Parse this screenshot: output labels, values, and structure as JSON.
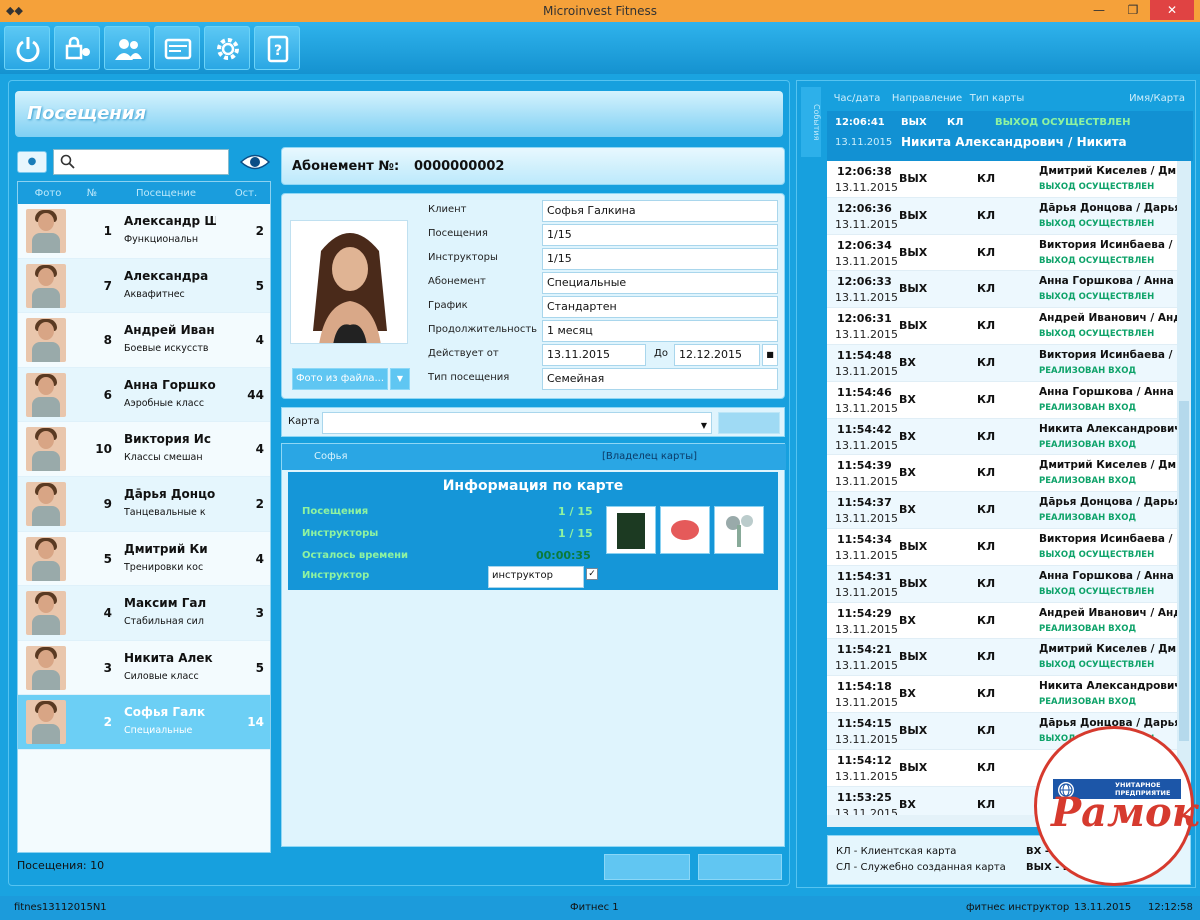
{
  "window": {
    "title": "Microinvest Fitness"
  },
  "page": {
    "title": "Посещения"
  },
  "client_table": {
    "headers": [
      "Фото",
      "№",
      "Посещение",
      "Ост."
    ],
    "rows": [
      {
        "num": "1",
        "name": "Александр Ш",
        "sub": "Функциональн",
        "rem": "2"
      },
      {
        "num": "7",
        "name": "Александра",
        "sub": "Аквафитнес",
        "rem": "5"
      },
      {
        "num": "8",
        "name": "Андрей Иван",
        "sub": "Боевые искусств",
        "rem": "4"
      },
      {
        "num": "6",
        "name": "Анна Горшко",
        "sub": "Аэробные класс",
        "rem": "44"
      },
      {
        "num": "10",
        "name": "Виктория Ис",
        "sub": "Классы смешан",
        "rem": "4"
      },
      {
        "num": "9",
        "name": "Дāрья Донцо",
        "sub": "Танцевальные к",
        "rem": "2"
      },
      {
        "num": "5",
        "name": "Дмитрий Ки",
        "sub": "Тренировки кос",
        "rem": "4"
      },
      {
        "num": "4",
        "name": "Максим Гал",
        "sub": "Стабильная сил",
        "rem": "3"
      },
      {
        "num": "3",
        "name": "Никита Алек",
        "sub": "Силовые класс",
        "rem": "5"
      },
      {
        "num": "2",
        "name": "Софья Галк",
        "sub": "Специальные",
        "rem": "14"
      }
    ],
    "selected_index": 9
  },
  "visits_count": "Посещения: 10",
  "subscription": {
    "label": "Абонемент №:",
    "number": "0000000002",
    "fields": [
      {
        "label": "Клиент",
        "value": "Софья Галкина"
      },
      {
        "label": "Посещения",
        "value": "1/15"
      },
      {
        "label": "Инструкторы",
        "value": "1/15"
      },
      {
        "label": "Абонемент",
        "value": "Специальные"
      },
      {
        "label": "График",
        "value": "Стандартен"
      },
      {
        "label": "Продолжительность",
        "value": "1 месяц"
      }
    ],
    "valid_from_label": "Действует от",
    "valid_from": "13.11.2015",
    "to_label": "До",
    "valid_to": "12.12.2015",
    "visit_type_label": "Тип посещения",
    "visit_type": "Семейная",
    "photo_button": "Фото из файла..."
  },
  "card": {
    "label": "Карта",
    "tab_owner": "Софья",
    "tab_role": "[Владелец карты]",
    "info_title": "Информация по карте",
    "rows": [
      {
        "label": "Посещения",
        "value": "1 / 15"
      },
      {
        "label": "Инструкторы",
        "value": "1 / 15"
      },
      {
        "label": "Осталось времени",
        "value": "00:00:35"
      },
      {
        "label": "Инструктор",
        "value": "инструктор"
      }
    ]
  },
  "events": {
    "side_tab": "События",
    "headers": [
      "Час/дата",
      "Направление",
      "Тип карты",
      "Имя/Карта"
    ],
    "latest": {
      "time": "12:06:41",
      "date": "13.11.2015",
      "dir": "ВЫХ",
      "type": "КЛ",
      "status": "ВЫХОД ОСУЩЕСТВЛЕН",
      "name": "Никита Александрович / Никита"
    },
    "rows": [
      {
        "time": "12:06:38",
        "date": "13.11.2015",
        "dir": "ВЫХ",
        "type": "КЛ",
        "name": "Дмитрий Киселев / Дми",
        "status": "ВЫХОД ОСУЩЕСТВЛЕН"
      },
      {
        "time": "12:06:36",
        "date": "13.11.2015",
        "dir": "ВЫХ",
        "type": "КЛ",
        "name": "Дāрья Донцова / Дарья",
        "status": "ВЫХОД ОСУЩЕСТВЛЕН"
      },
      {
        "time": "12:06:34",
        "date": "13.11.2015",
        "dir": "ВЫХ",
        "type": "КЛ",
        "name": "Виктория Исинбаева / В",
        "status": "ВЫХОД ОСУЩЕСТВЛЕН"
      },
      {
        "time": "12:06:33",
        "date": "13.11.2015",
        "dir": "ВЫХ",
        "type": "КЛ",
        "name": "Анна Горшкова / Анна",
        "status": "ВЫХОД ОСУЩЕСТВЛЕН"
      },
      {
        "time": "12:06:31",
        "date": "13.11.2015",
        "dir": "ВЫХ",
        "type": "КЛ",
        "name": "Андрей Иванович / Анд",
        "status": "ВЫХОД ОСУЩЕСТВЛЕН"
      },
      {
        "time": "11:54:48",
        "date": "13.11.2015",
        "dir": "ВХ",
        "type": "КЛ",
        "name": "Виктория Исинбаева / В",
        "status": "РЕАЛИЗОВАН ВХОД"
      },
      {
        "time": "11:54:46",
        "date": "13.11.2015",
        "dir": "ВХ",
        "type": "КЛ",
        "name": "Анна Горшкова / Анна",
        "status": "РЕАЛИЗОВАН ВХОД"
      },
      {
        "time": "11:54:42",
        "date": "13.11.2015",
        "dir": "ВХ",
        "type": "КЛ",
        "name": "Никита Александрович /",
        "status": "РЕАЛИЗОВАН ВХОД"
      },
      {
        "time": "11:54:39",
        "date": "13.11.2015",
        "dir": "ВХ",
        "type": "КЛ",
        "name": "Дмитрий Киселев / Дми",
        "status": "РЕАЛИЗОВАН ВХОД"
      },
      {
        "time": "11:54:37",
        "date": "13.11.2015",
        "dir": "ВХ",
        "type": "КЛ",
        "name": "Дāрья Донцова / Дарья",
        "status": "РЕАЛИЗОВАН ВХОД"
      },
      {
        "time": "11:54:34",
        "date": "13.11.2015",
        "dir": "ВЫХ",
        "type": "КЛ",
        "name": "Виктория Исинбаева / В",
        "status": "ВЫХОД ОСУЩЕСТВЛЕН"
      },
      {
        "time": "11:54:31",
        "date": "13.11.2015",
        "dir": "ВЫХ",
        "type": "КЛ",
        "name": "Анна Горшкова / Анна",
        "status": "ВЫХОД ОСУЩЕСТВЛЕН"
      },
      {
        "time": "11:54:29",
        "date": "13.11.2015",
        "dir": "ВХ",
        "type": "КЛ",
        "name": "Андрей Иванович / Анд",
        "status": "РЕАЛИЗОВАН ВХОД"
      },
      {
        "time": "11:54:21",
        "date": "13.11.2015",
        "dir": "ВЫХ",
        "type": "КЛ",
        "name": "Дмитрий Киселев / Дми",
        "status": "ВЫХОД ОСУЩЕСТВЛЕН"
      },
      {
        "time": "11:54:18",
        "date": "13.11.2015",
        "dir": "ВХ",
        "type": "КЛ",
        "name": "Никита Александрович /",
        "status": "РЕАЛИЗОВАН ВХОД"
      },
      {
        "time": "11:54:15",
        "date": "13.11.2015",
        "dir": "ВЫХ",
        "type": "КЛ",
        "name": "Дāрья Донцова / Дарья",
        "status": "ВЫХОД ОСУЩЕСТВЛЕН"
      },
      {
        "time": "11:54:12",
        "date": "13.11.2015",
        "dir": "ВЫХ",
        "type": "КЛ",
        "name": "",
        "status": ""
      },
      {
        "time": "11:53:25",
        "date": "13.11.2015",
        "dir": "ВХ",
        "type": "КЛ",
        "name": "",
        "status": ""
      }
    ],
    "legend": {
      "kl": "КЛ - Клиентская карта",
      "sl": "СЛ - Служебно созданная карта",
      "vx": "ВХ - Вход",
      "vyx": "ВЫХ - Выход"
    }
  },
  "status_bar": {
    "left": "fitnes13112015N1",
    "center": "Фитнес 1",
    "user": "фитнес инструктор",
    "date": "13.11.2015",
    "time": "12:12:58"
  },
  "watermark": {
    "small": "УНИТАРНОЕ ПРЕДПРИЯТИЕ",
    "big": "Рамок"
  },
  "colors": {
    "accent": "#1aa3e0",
    "title_bar": "#f5a13a",
    "status_ok": "#0fa36a"
  }
}
